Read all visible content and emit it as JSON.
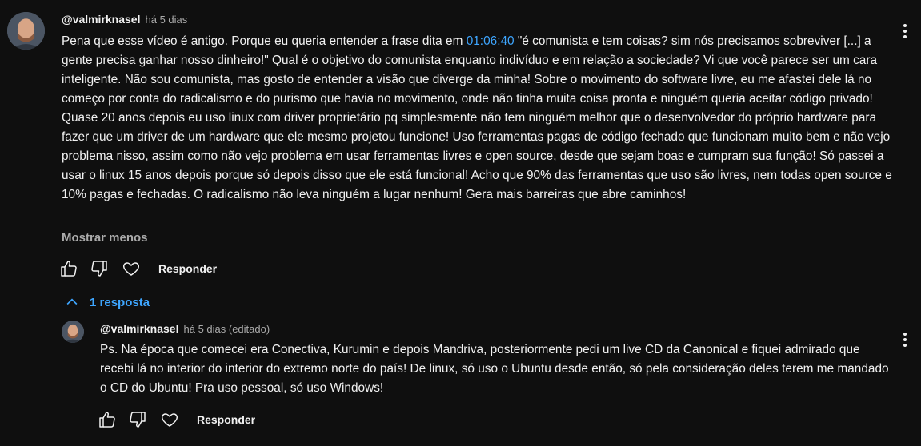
{
  "main_comment": {
    "author": "@valmirknasel",
    "time": "há 5 dias",
    "text_before_ts": "Pena que esse vídeo é antigo. Porque eu queria entender a frase dita em ",
    "timestamp": "01:06:40",
    "text_after_ts": " \"é comunista e tem coisas? sim nós precisamos sobreviver [...] a gente precisa ganhar nosso dinheiro!\" Qual é o objetivo do comunista enquanto indivíduo e em relação a sociedade? Vi que você parece ser um cara inteligente. Não sou comunista, mas gosto de entender a visão que diverge da minha! Sobre o movimento do software livre, eu me afastei dele lá no começo por conta do radicalismo e do purismo que havia no movimento, onde não tinha muita coisa pronta e ninguém queria aceitar código privado! Quase 20 anos depois eu uso linux com driver proprietário pq simplesmente não tem ninguém melhor que o desenvolvedor do próprio hardware para fazer que um driver de um hardware que ele mesmo projetou funcione! Uso ferramentas pagas de código fechado que funcionam muito bem e não vejo problema nisso, assim como não vejo problema em usar ferramentas livres e open source, desde que sejam boas e cumpram sua função! Só passei a usar o linux 15 anos depois porque só depois disso que ele está funcional! Acho que 90% das ferramentas que uso são livres, nem todas open source e 10% pagas e fechadas. O radicalismo não leva ninguém a lugar nenhum! Gera mais barreiras que abre caminhos!",
    "show_less": "Mostrar menos",
    "reply_label": "Responder"
  },
  "replies_toggle": {
    "label": "1 resposta"
  },
  "reply_comment": {
    "author": "@valmirknasel",
    "time": "há 5 dias (editado)",
    "text": "Ps. Na época que comecei era Conectiva, Kurumin e depois Mandriva, posteriormente pedi um live CD da Canonical e fiquei admirado que recebi lá no interior do interior do extremo norte do país! De linux, só uso o Ubuntu desde então, só pela consideração deles terem me mandado o CD do Ubuntu! Pra uso pessoal, só uso Windows!",
    "reply_label": "Responder"
  },
  "colors": {
    "background": "#0f0f0f",
    "text": "#f1f1f1",
    "secondary": "#aaaaaa",
    "link": "#3ea6ff"
  },
  "icons": [
    "like-icon",
    "dislike-icon",
    "heart-icon",
    "kebab-menu-icon",
    "chevron-up-icon",
    "avatar"
  ]
}
